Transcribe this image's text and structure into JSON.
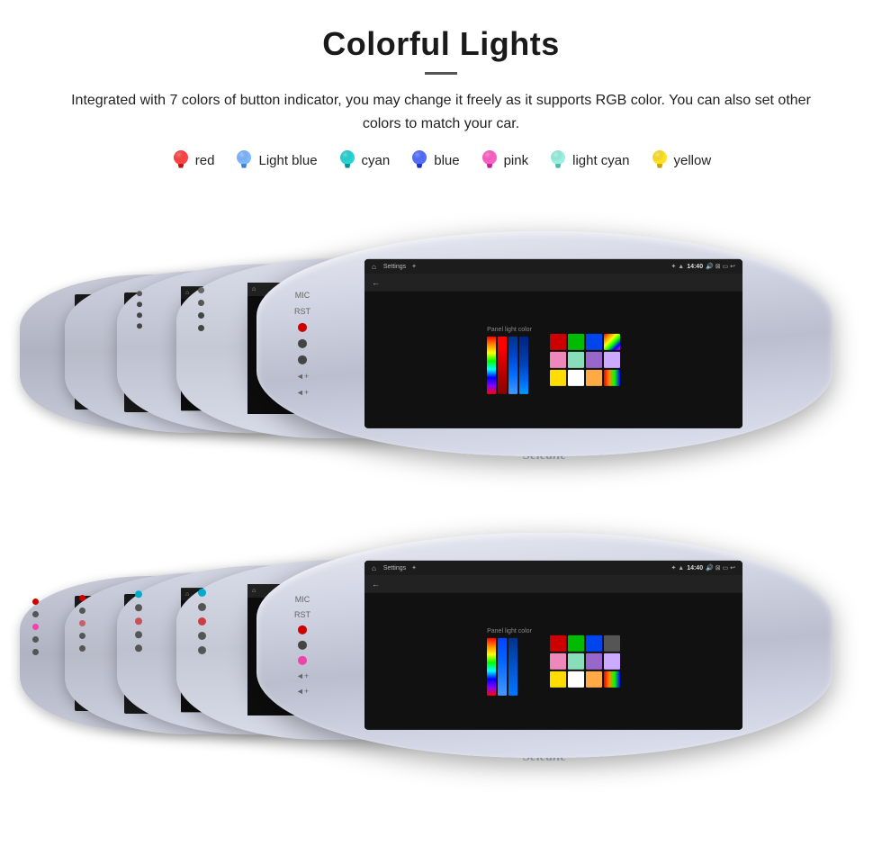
{
  "header": {
    "title": "Colorful Lights",
    "description": "Integrated with 7 colors of button indicator, you may change it freely as it supports RGB color. You can also set other colors to match your car.",
    "colors": [
      {
        "name": "red",
        "color": "#ff2222",
        "label": "red"
      },
      {
        "name": "light-blue",
        "color": "#66aaff",
        "label": "Light blue"
      },
      {
        "name": "cyan",
        "color": "#00dddd",
        "label": "cyan"
      },
      {
        "name": "blue",
        "color": "#3355ff",
        "label": "blue"
      },
      {
        "name": "pink",
        "color": "#ff44bb",
        "label": "pink"
      },
      {
        "name": "light-cyan",
        "color": "#88eedd",
        "label": "light cyan"
      },
      {
        "name": "yellow",
        "color": "#ffdd00",
        "label": "yellow"
      }
    ]
  },
  "screen": {
    "status_time": "14:40",
    "settings_title": "Settings",
    "panel_light_label": "Panel light color",
    "back_arrow": "←",
    "home_icon": "⌂"
  },
  "watermark": "Seicane"
}
